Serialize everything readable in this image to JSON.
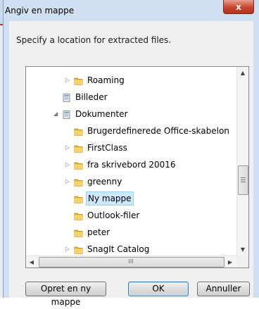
{
  "dialog": {
    "title": "Angiv en mappe",
    "close_label": "x",
    "instruction": "Specify a location for extracted files."
  },
  "tree": {
    "items": [
      {
        "label": "Roaming",
        "icon": "folder-icon",
        "expander": "collapsed"
      },
      {
        "label": "Billeder",
        "icon": "library-icon",
        "expander": "none"
      },
      {
        "label": "Dokumenter",
        "icon": "library-icon",
        "expander": "expanded"
      },
      {
        "label": "Brugerdefinerede Office-skabelon",
        "icon": "folder-icon",
        "expander": "none"
      },
      {
        "label": "FirstClass",
        "icon": "folder-icon",
        "expander": "collapsed"
      },
      {
        "label": "fra skrivebord 20016",
        "icon": "folder-icon",
        "expander": "collapsed"
      },
      {
        "label": "greenny",
        "icon": "folder-icon",
        "expander": "collapsed"
      },
      {
        "label": "Ny mappe",
        "icon": "folder-icon",
        "expander": "none",
        "selected": true
      },
      {
        "label": "Outlook-filer",
        "icon": "folder-icon",
        "expander": "none"
      },
      {
        "label": "peter",
        "icon": "folder-icon",
        "expander": "none"
      },
      {
        "label": "SnagIt Catalog",
        "icon": "folder-icon",
        "expander": "collapsed"
      }
    ]
  },
  "scrollbar": {
    "h_grip": "III"
  },
  "buttons": {
    "new_folder": "Opret en ny mappe",
    "ok": "OK",
    "cancel": "Annuller"
  },
  "colors": {
    "selection": "#cce8ff",
    "folder": "#e8b830",
    "window_frame": "#cfe0f2"
  }
}
